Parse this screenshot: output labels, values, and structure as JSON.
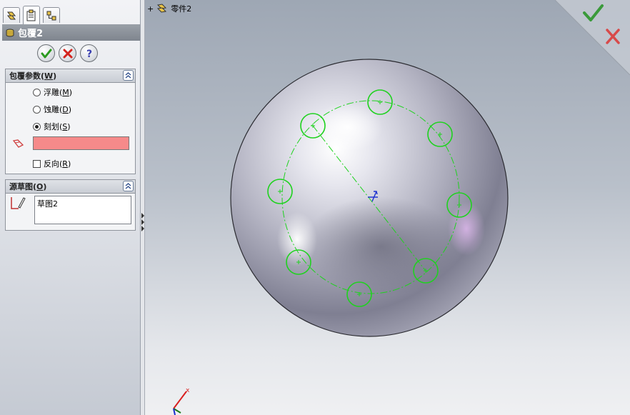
{
  "panel": {
    "tabs": [
      {
        "name": "feature-manager",
        "icon": "feature-tree-icon"
      },
      {
        "name": "property-manager",
        "icon": "property-manager-icon",
        "active": true
      },
      {
        "name": "configuration-manager",
        "icon": "configuration-icon"
      }
    ],
    "header_title": "包覆2",
    "header_icon": "wrap-feature-icon",
    "actions": [
      {
        "name": "ok",
        "icon": "green-check-icon"
      },
      {
        "name": "cancel",
        "icon": "red-x-icon"
      },
      {
        "name": "help",
        "icon": "question-icon"
      }
    ]
  },
  "wrap_params": {
    "title": "包覆参数(W)",
    "options": [
      {
        "label": "浮雕(M)",
        "checked": false
      },
      {
        "label": "蚀雕(D)",
        "checked": false
      },
      {
        "label": "刻划(S)",
        "checked": true
      }
    ],
    "face_selection_color": "#f68a8a",
    "reverse_label": "反向(R)",
    "reverse_checked": false
  },
  "source_sketch": {
    "title": "源草图(O)",
    "items": [
      "草图2"
    ]
  },
  "viewport": {
    "tree_item_label": "零件2",
    "expand_symbol": "+",
    "accent_green": "#22cc22",
    "confirm_icon": "confirm-check-icon",
    "cancel_icon": "cancel-x-icon"
  }
}
